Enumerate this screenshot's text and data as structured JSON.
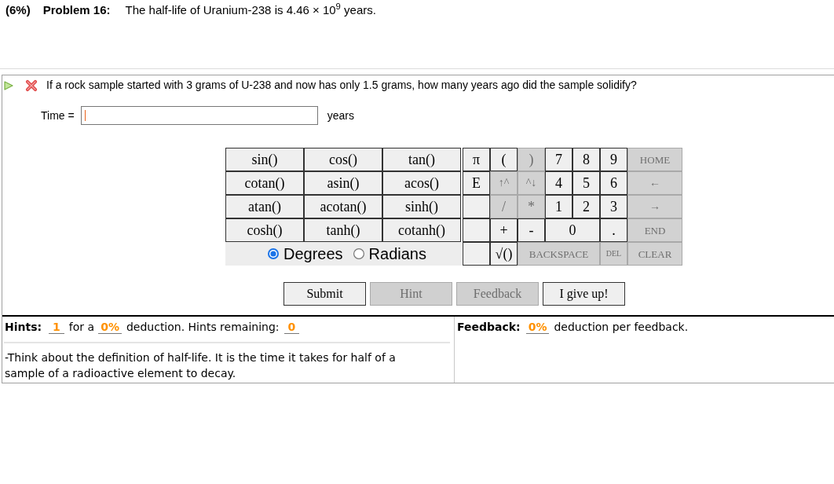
{
  "problem": {
    "weight": "(6%)",
    "title": "Problem 16:",
    "statement": "The half-life of Uranium-238 is 4.46 × 10$^{9}$ years."
  },
  "question": {
    "text": "If a rock sample started with 3 grams of U-238 and now has only 1.5 grams, how many years ago did the sample solidify?"
  },
  "answer": {
    "label": "Time =",
    "focused": true,
    "unit": "years"
  },
  "keypad": {
    "functions": [
      "sin()",
      "cos()",
      "tan()",
      "cotan()",
      "asin()",
      "acos()",
      "atan()",
      "acotan()",
      "sinh()",
      "cosh()",
      "tanh()",
      "cotanh()"
    ],
    "angle_modes": [
      {
        "label": "Degrees",
        "selected": true
      },
      {
        "label": "Radians",
        "selected": false
      }
    ],
    "keys": [
      [
        {
          "kind": "symbol",
          "label": "π",
          "disabled": false
        },
        {
          "kind": "symbol",
          "label": "(",
          "disabled": false
        },
        {
          "kind": "symbol",
          "label": ")",
          "disabled": true
        },
        {
          "kind": "symbol",
          "label": "7",
          "disabled": false
        },
        {
          "kind": "symbol",
          "label": "8",
          "disabled": false
        },
        {
          "kind": "symbol",
          "label": "9",
          "disabled": false
        },
        {
          "kind": "command",
          "label": "HOME",
          "disabled": true
        }
      ],
      [
        {
          "kind": "symbol",
          "label": "E",
          "disabled": false
        },
        {
          "kind": "arrow",
          "label": "↑^",
          "disabled": true
        },
        {
          "kind": "arrow",
          "label": "^↓",
          "disabled": true
        },
        {
          "kind": "symbol",
          "label": "4",
          "disabled": false
        },
        {
          "kind": "symbol",
          "label": "5",
          "disabled": false
        },
        {
          "kind": "symbol",
          "label": "6",
          "disabled": false
        },
        {
          "kind": "arrow",
          "label": "←",
          "disabled": true
        }
      ],
      [
        {
          "kind": "blank"
        },
        {
          "kind": "symbol",
          "label": "/",
          "disabled": true
        },
        {
          "kind": "symbol",
          "label": "*",
          "disabled": true
        },
        {
          "kind": "symbol",
          "label": "1",
          "disabled": false
        },
        {
          "kind": "symbol",
          "label": "2",
          "disabled": false
        },
        {
          "kind": "symbol",
          "label": "3",
          "disabled": false
        },
        {
          "kind": "arrow",
          "label": "→",
          "disabled": true
        }
      ],
      [
        {
          "kind": "blank"
        },
        {
          "kind": "symbol",
          "label": "+",
          "disabled": false
        },
        {
          "kind": "symbol",
          "label": "-",
          "disabled": false
        },
        {
          "kind": "symbol",
          "label": "0",
          "disabled": false
        },
        {
          "kind": "symbol",
          "label": ".",
          "disabled": false
        },
        {
          "kind": "command",
          "label": "END",
          "disabled": true
        }
      ],
      [
        {
          "kind": "blank"
        },
        {
          "kind": "symbol",
          "label": "√()",
          "disabled": false
        },
        {
          "kind": "command",
          "label": "BACKSPACE",
          "disabled": true
        },
        {
          "kind": "command",
          "label": "DEL",
          "disabled": true
        },
        {
          "kind": "command",
          "label": "CLEAR",
          "disabled": true
        }
      ]
    ]
  },
  "buttons": [
    {
      "label": "Submit",
      "disabled": false
    },
    {
      "label": "Hint",
      "disabled": true
    },
    {
      "label": "Feedback",
      "disabled": true
    },
    {
      "label": "I give up!",
      "disabled": false
    }
  ],
  "hints": {
    "label": "Hints:",
    "count": "1",
    "text_1": "for a",
    "deduction": "0%",
    "text_2": "deduction. Hints remaining:",
    "remaining": "0",
    "message": "-Think about the definition of half-life. It is the time it takes for half of a sample of a radioactive element to decay."
  },
  "feedback": {
    "label": "Feedback:",
    "deduction": "0%",
    "text": "deduction per feedback."
  }
}
